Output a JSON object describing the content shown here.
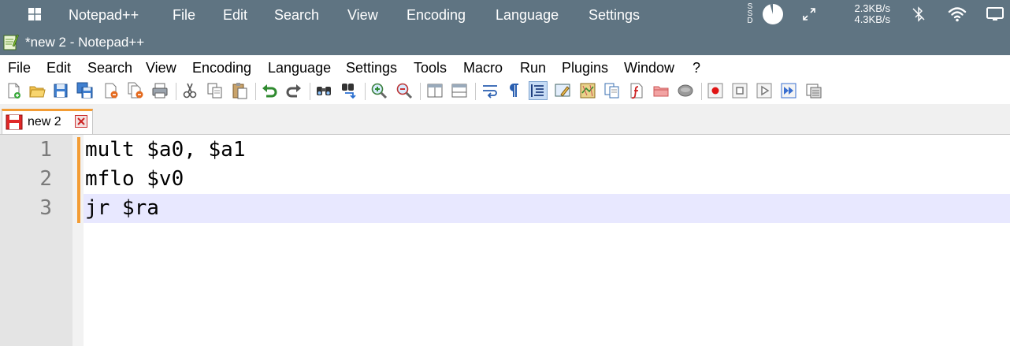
{
  "system_bar": {
    "app_name": "Notepad++",
    "menus": [
      "File",
      "Edit",
      "Search",
      "View",
      "Encoding",
      "Language",
      "Settings"
    ],
    "ssd_label": "S S D",
    "net_up": "2.3KB/s",
    "net_down": "4.3KB/s"
  },
  "window": {
    "title": "*new 2 - Notepad++"
  },
  "menubar": {
    "items": [
      "File",
      "Edit",
      "Search",
      "View",
      "Encoding",
      "Language",
      "Settings",
      "Tools",
      "Macro",
      "Run",
      "Plugins",
      "Window",
      "?"
    ]
  },
  "toolbar": {
    "icons": [
      "new-file-icon",
      "open-file-icon",
      "save-icon",
      "save-all-icon",
      "close-icon",
      "close-all-icon",
      "print-icon",
      "cut-icon",
      "copy-icon",
      "paste-icon",
      "undo-icon",
      "redo-icon",
      "find-icon",
      "replace-icon",
      "zoom-in-icon",
      "zoom-out-icon",
      "sync-vertical-icon",
      "sync-horizontal-icon",
      "word-wrap-icon",
      "show-all-characters-icon",
      "indent-guide-icon",
      "user-language-icon",
      "document-map-icon",
      "document-list-icon",
      "function-list-icon",
      "folder-as-workspace-icon",
      "monitoring-icon",
      "record-macro-icon",
      "stop-recording-icon",
      "play-macro-icon",
      "run-macro-multiple-icon",
      "save-macro-icon"
    ]
  },
  "tabs": [
    {
      "label": "new 2",
      "modified": true
    }
  ],
  "editor": {
    "lines": [
      {
        "number": "1",
        "text": "mult $a0, $a1"
      },
      {
        "number": "2",
        "text": "mflo $v0"
      },
      {
        "number": "3",
        "text": "jr $ra"
      }
    ],
    "current_line": 3
  },
  "colors": {
    "title_bar": "#5f7482",
    "tab_accent": "#f39c34",
    "current_line_highlight": "#e8e8ff",
    "gutter": "#e4e4e4"
  }
}
